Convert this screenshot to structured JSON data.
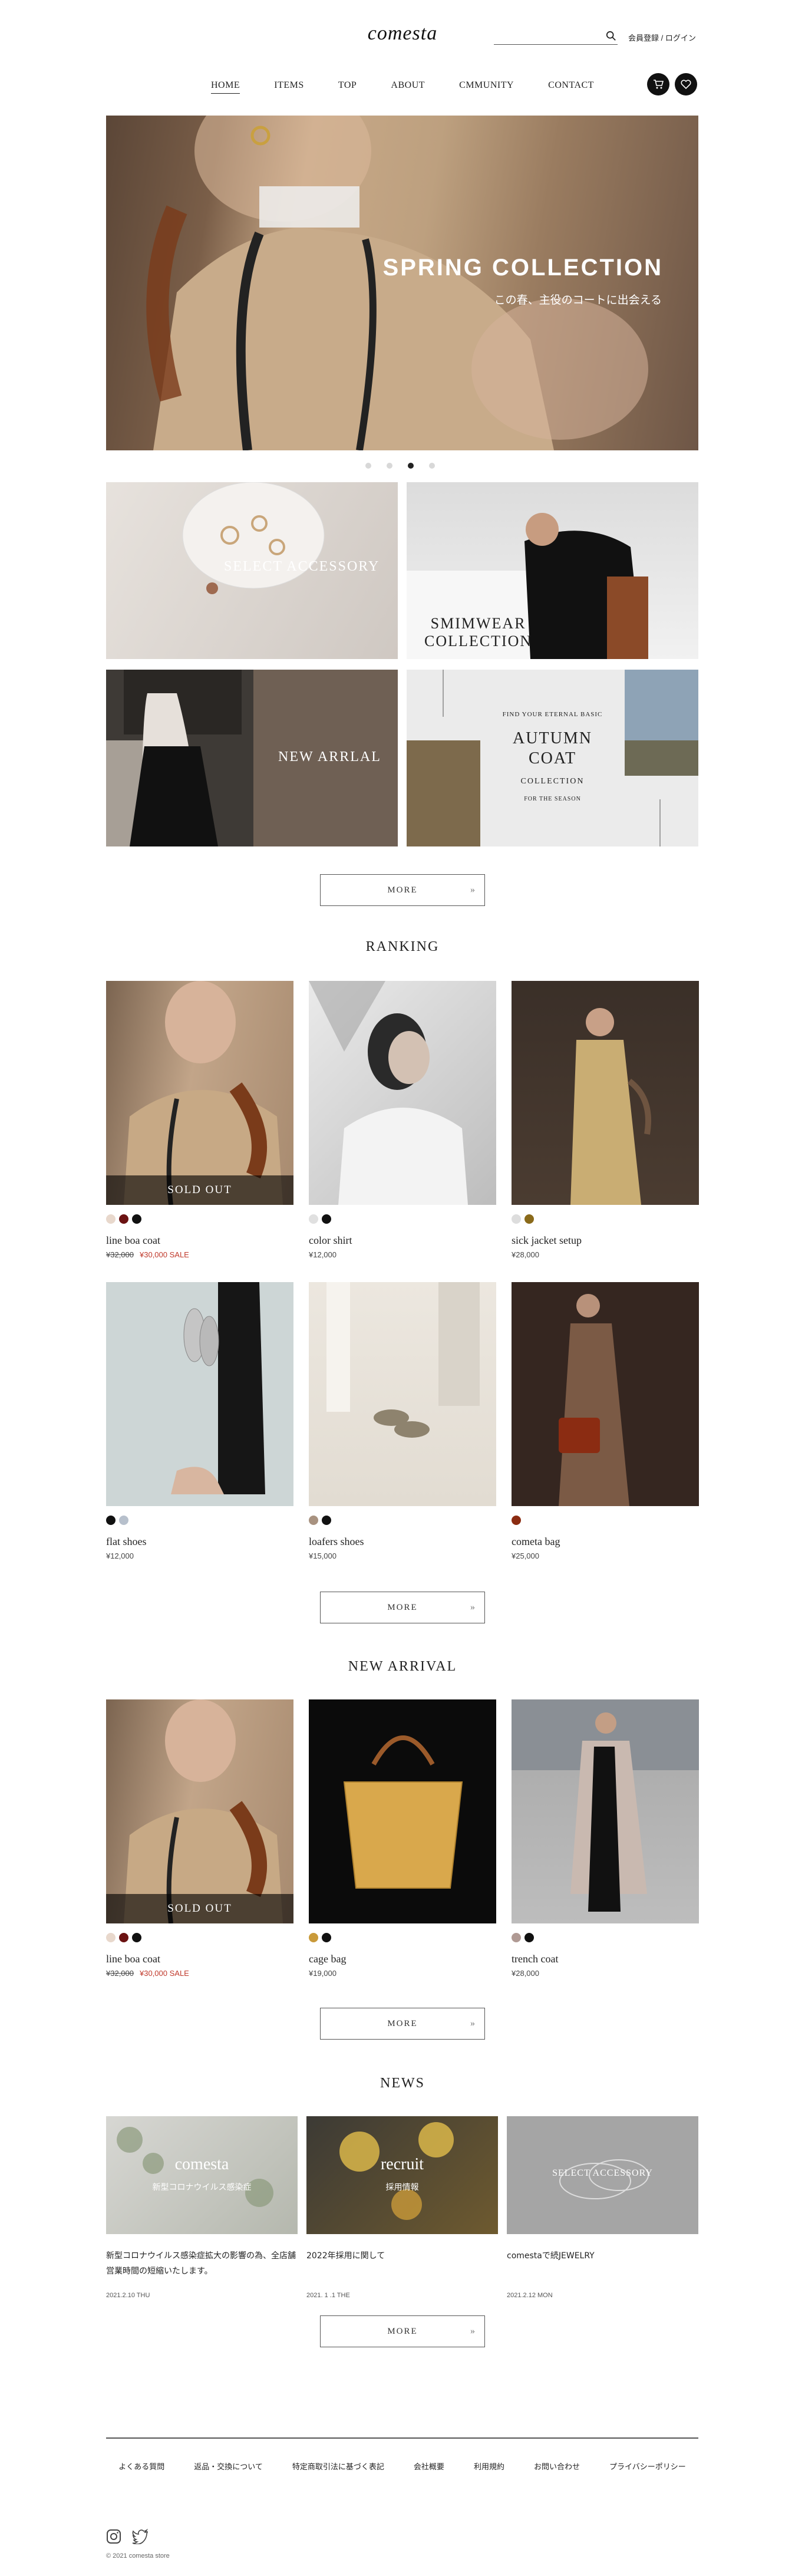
{
  "header": {
    "logo": "comesta",
    "search_placeholder": "",
    "login": "会員登録 / ログイン"
  },
  "nav": [
    "HOME",
    "ITEMS",
    "TOP",
    "ABOUT",
    "CMMUNITY",
    "CONTACT"
  ],
  "hero": {
    "title": "SPRING COLLECTION",
    "subtitle": "この春、主役のコートに出会える",
    "slides": 4,
    "active_slide": 3
  },
  "banners": {
    "accessory": "SELECT ACCESSORY",
    "swimwear_line1": "SMIMWEAR",
    "swimwear_line2": "COLLECTION",
    "new_arrival": "NEW ARRLAL",
    "autumn_top": "FIND YOUR ETERNAL BASIC",
    "autumn_title1": "AUTUMN",
    "autumn_title2": "COAT",
    "autumn_collection": "COLLECTION",
    "autumn_for": "FOR THE SEASON"
  },
  "more_label": "MORE",
  "ranking": {
    "title": "RANKING",
    "items": [
      {
        "name": "line boa coat",
        "old_price": "¥32,000",
        "price": "¥30,000 SALE",
        "sold_out": "SOLD OUT",
        "colors": [
          "#e8d8cc",
          "#6b1212",
          "#111111"
        ]
      },
      {
        "name": "color shirt",
        "price": "¥12,000",
        "colors": [
          "#e0e0e0",
          "#111111"
        ]
      },
      {
        "name": "sick jacket setup",
        "price": "¥28,000",
        "colors": [
          "#dddddd",
          "#8a6a1a"
        ]
      },
      {
        "name": "flat shoes",
        "price": "¥12,000",
        "colors": [
          "#111111",
          "#b7c0cc"
        ]
      },
      {
        "name": "loafers shoes",
        "price": "¥15,000",
        "colors": [
          "#a89280",
          "#111111"
        ]
      },
      {
        "name": "cometa bag",
        "price": "¥25,000",
        "colors": [
          "#8b2c12"
        ]
      }
    ]
  },
  "new_arrival": {
    "title": "NEW ARRIVAL",
    "items": [
      {
        "name": "line boa coat",
        "old_price": "¥32,000",
        "price": "¥30,000 SALE",
        "sold_out": "SOLD OUT",
        "colors": [
          "#e8d8cc",
          "#6b1212",
          "#111111"
        ]
      },
      {
        "name": "cage bag",
        "price": "¥19,000",
        "colors": [
          "#c99a3a",
          "#111111"
        ]
      },
      {
        "name": "trench coat",
        "price": "¥28,000",
        "colors": [
          "#b09a94",
          "#111111"
        ]
      }
    ]
  },
  "news": {
    "title": "NEWS",
    "items": [
      {
        "img_title": "comesta",
        "img_sub": "新型コロナウイルス感染症",
        "text": "新型コロナウイルス感染症拡大の影響の為、全店舗営業時間の短縮いたします。",
        "date": "2021.2.10 THU"
      },
      {
        "img_title": "recruit",
        "img_sub": "採用情報",
        "text": "2022年採用に関して",
        "date": "2021. 1 .1 THE"
      },
      {
        "img_title": "SELECT ACCESSORY",
        "img_sub": "",
        "text": "comestaで続JEWELRY",
        "date": "2021.2.12 MON"
      }
    ]
  },
  "footer": {
    "links": [
      "よくある質問",
      "返品・交換について",
      "特定商取引法に基づく表記",
      "会社概要",
      "利用規約",
      "お問い合わせ",
      "プライバシーポリシー"
    ],
    "copyright": "© 2021 comesta store"
  }
}
